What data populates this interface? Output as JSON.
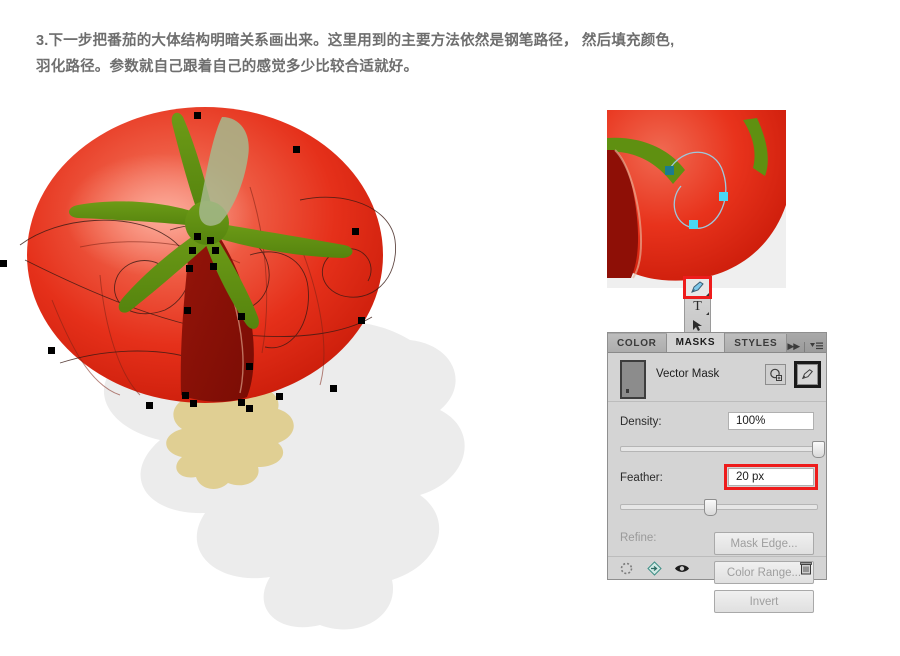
{
  "caption": {
    "line1": "3.下一步把番茄的大体结构明暗关系画出来。这里用到的主要方法依然是钢笔路径， 然后填充颜色,",
    "line2": "羽化路径。参数就自己跟着自己的感觉多少比较合适就好。"
  },
  "artwork": {
    "name": "tomato-illustration",
    "body_color_light": "#f36a56",
    "body_color": "#e8331c",
    "body_color_dark": "#c41608",
    "calyx_color": "#5f9011",
    "calyx_highlight": "#9fb383",
    "shadow_wedge_color": "#8e0f06",
    "ground_shadow_color": "#ececec",
    "tan_blob_color": "#e0cf93",
    "anchor_color": "#000000",
    "path_stroke_color": "#4a2a24"
  },
  "preview": {
    "name": "zoomed-canvas-preview",
    "background": "#efefef",
    "path_stroke": "#9ec8dd",
    "anchor_color": "#49d7f2",
    "anchor_selected_color": "#1b7c8e"
  },
  "toolbar": {
    "pen_tool": "pen-tool",
    "type_tool": "T",
    "path_select_tool": "path-selection-tool",
    "highlight_color": "#ee1c1c"
  },
  "panel": {
    "tabs": [
      {
        "label": "COLOR",
        "active": false
      },
      {
        "label": "MASKS",
        "active": true
      },
      {
        "label": "STYLES",
        "active": false
      }
    ],
    "collapse_icon": "double-chevron-right-icon",
    "menu_icon": "panel-menu-icon",
    "mask": {
      "title": "Vector Mask",
      "thumbnail": "vector-mask-thumbnail",
      "add_pixel_mask_icon": "add-pixel-mask-icon",
      "add_vector_mask_icon": "add-vector-mask-icon"
    },
    "density": {
      "label": "Density:",
      "value": "100%",
      "slider_percent": 100
    },
    "feather": {
      "label": "Feather:",
      "value": "20 px",
      "slider_percent": 45,
      "highlighted": true
    },
    "refine": {
      "label": "Refine:",
      "disabled": true,
      "buttons": [
        "Mask Edge...",
        "Color Range...",
        "Invert"
      ]
    },
    "footer_icons": [
      "load-selection-icon",
      "apply-mask-icon",
      "toggle-mask-visibility-icon",
      "delete-mask-icon"
    ]
  }
}
